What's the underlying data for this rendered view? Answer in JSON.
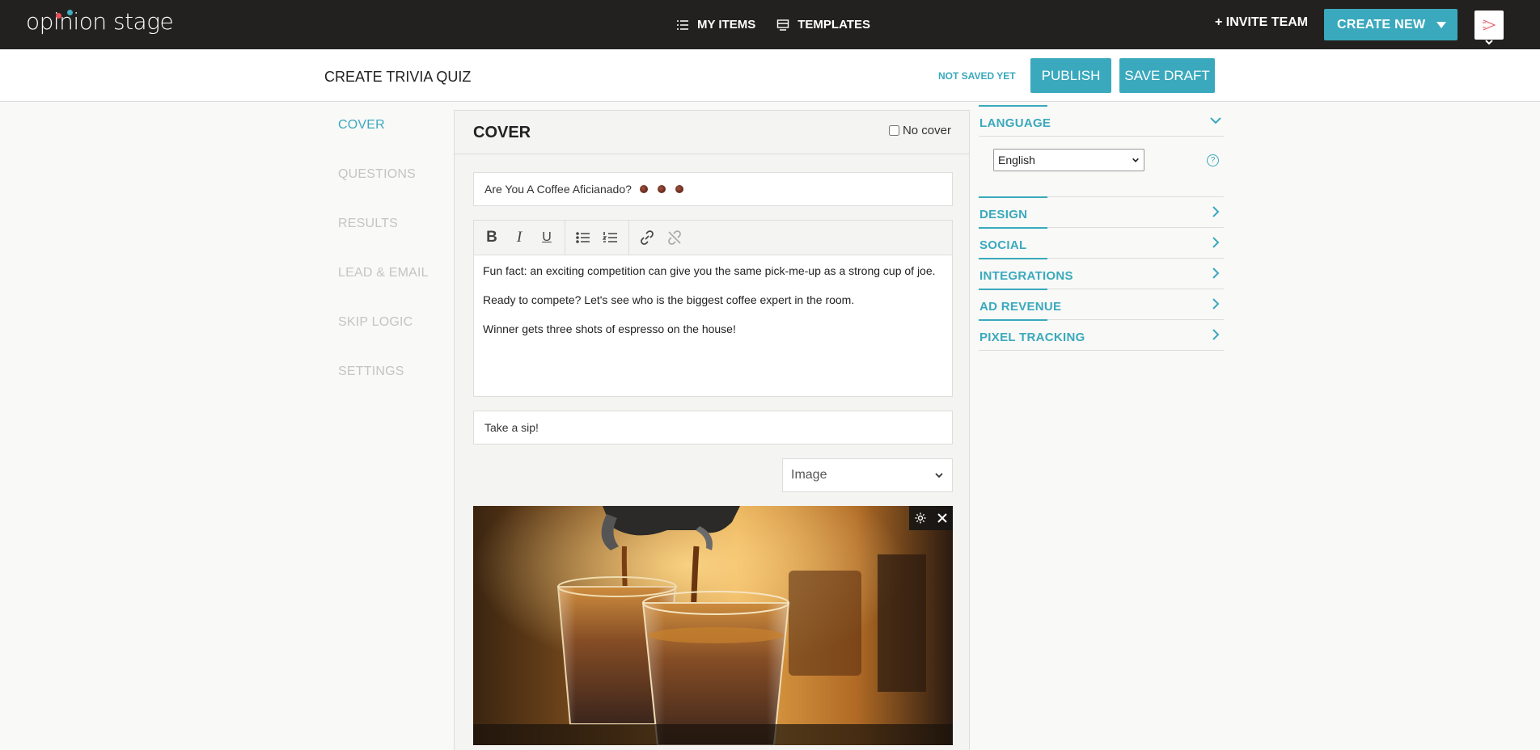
{
  "topnav": {
    "logo": "opinion stage",
    "my_items": "MY ITEMS",
    "templates": "TEMPLATES",
    "invite_team": "+ INVITE TEAM",
    "create_new": "CREATE NEW"
  },
  "subheader": {
    "title": "CREATE TRIVIA QUIZ",
    "status": "NOT SAVED YET",
    "publish": "PUBLISH",
    "save_draft": "SAVE DRAFT"
  },
  "leftnav": [
    "COVER",
    "QUESTIONS",
    "RESULTS",
    "LEAD & EMAIL",
    "SKIP LOGIC",
    "SETTINGS"
  ],
  "cover": {
    "heading": "COVER",
    "no_cover_label": "No cover",
    "title_value": "Are You A Coffee Aficianado?",
    "description": [
      "Fun fact: an exciting competition can give you the same pick-me-up as a strong cup of joe.",
      "Ready to compete? Let's see who is the biggest coffee expert in the room.",
      "Winner gets three shots of espresso on the house!"
    ],
    "button_text": "Take a sip!",
    "media_type": "Image"
  },
  "settings_panel": {
    "language": "LANGUAGE",
    "language_value": "English",
    "sections": [
      "DESIGN",
      "SOCIAL",
      "INTEGRATIONS",
      "AD REVENUE",
      "PIXEL TRACKING"
    ]
  },
  "colors": {
    "accent": "#3aa9bd",
    "nav_bg": "#232120"
  }
}
